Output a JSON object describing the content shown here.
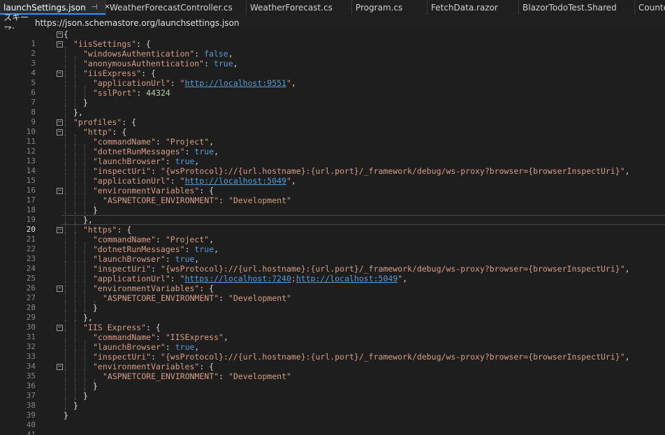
{
  "tabs": [
    {
      "label": "launchSettings.json",
      "active": true
    },
    {
      "label": "WeatherForecastController.cs"
    },
    {
      "label": "WeatherForecast.cs"
    },
    {
      "label": "Program.cs"
    },
    {
      "label": "FetchData.razor"
    },
    {
      "label": "BlazorTodoTest.Shared"
    },
    {
      "label": "Counte"
    }
  ],
  "schema": {
    "label": "スキーマ:",
    "value": "https://json.schemastore.org/launchsettings.json"
  },
  "editor": {
    "current_line": 20,
    "lines": [
      {
        "n": "1",
        "fold": true
      },
      {
        "n": "2",
        "fold": true
      },
      {
        "n": "3"
      },
      {
        "n": "4"
      },
      {
        "n": "5",
        "fold": true
      },
      {
        "n": "6"
      },
      {
        "n": "7"
      },
      {
        "n": "8"
      },
      {
        "n": "9"
      },
      {
        "n": "10",
        "fold": true
      },
      {
        "n": "11",
        "fold": true
      },
      {
        "n": "12"
      },
      {
        "n": "13"
      },
      {
        "n": "14"
      },
      {
        "n": "15"
      },
      {
        "n": "16"
      },
      {
        "n": "17",
        "fold": true
      },
      {
        "n": "18"
      },
      {
        "n": "19"
      },
      {
        "n": "20"
      },
      {
        "n": "21",
        "fold": true
      },
      {
        "n": "22"
      },
      {
        "n": "23"
      },
      {
        "n": "24"
      },
      {
        "n": "25"
      },
      {
        "n": "26"
      },
      {
        "n": "27",
        "fold": true
      },
      {
        "n": "28"
      },
      {
        "n": "29"
      },
      {
        "n": "30"
      },
      {
        "n": "31",
        "fold": true
      },
      {
        "n": "32"
      },
      {
        "n": "33"
      },
      {
        "n": "34"
      },
      {
        "n": "35",
        "fold": true
      },
      {
        "n": "36"
      },
      {
        "n": "37"
      },
      {
        "n": "38"
      },
      {
        "n": "39"
      },
      {
        "n": "40"
      },
      {
        "n": "41"
      }
    ],
    "code": {
      "l1": "{",
      "l2_key": "\"iisSettings\"",
      "l2_rest": ": {",
      "l3_key": "\"windowsAuthentication\"",
      "l3_val": "false",
      "l4_key": "\"anonymousAuthentication\"",
      "l4_val": "true",
      "l5_key": "\"iisExpress\"",
      "l5_rest": ": {",
      "l6_key": "\"applicationUrl\"",
      "l6_q1": "\"",
      "l6_url": "http://localhost:9551",
      "l6_q2": "\"",
      "l7_key": "\"sslPort\"",
      "l7_val": "44324",
      "l8": "}",
      "l9": "},",
      "l10_key": "\"profiles\"",
      "l10_rest": ": {",
      "l11_key": "\"http\"",
      "l11_rest": ": {",
      "l12_key": "\"commandName\"",
      "l12_val": "\"Project\"",
      "l13_key": "\"dotnetRunMessages\"",
      "l13_val": "true",
      "l14_key": "\"launchBrowser\"",
      "l14_val": "true",
      "l15_key": "\"inspectUri\"",
      "l15_val": "\"{wsProtocol}://{url.hostname}:{url.port}/_framework/debug/ws-proxy?browser={browserInspectUri}\"",
      "l16_key": "\"applicationUrl\"",
      "l16_q1": "\"",
      "l16_url": "http://localhost:5049",
      "l16_q2": "\"",
      "l17_key": "\"environmentVariables\"",
      "l17_rest": ": {",
      "l18_key": "\"ASPNETCORE_ENVIRONMENT\"",
      "l18_val": "\"Development\"",
      "l19": "}",
      "l20": "},",
      "l21_key": "\"https\"",
      "l21_rest": ": {",
      "l22_key": "\"commandName\"",
      "l22_val": "\"Project\"",
      "l23_key": "\"dotnetRunMessages\"",
      "l23_val": "true",
      "l24_key": "\"launchBrowser\"",
      "l24_val": "true",
      "l25_key": "\"inspectUri\"",
      "l25_val": "\"{wsProtocol}://{url.hostname}:{url.port}/_framework/debug/ws-proxy?browser={browserInspectUri}\"",
      "l26_key": "\"applicationUrl\"",
      "l26_q1": "\"",
      "l26_url1": "https://localhost:7240",
      "l26_sep": ";",
      "l26_url2": "http://localhost:5049",
      "l26_q2": "\"",
      "l27_key": "\"environmentVariables\"",
      "l27_rest": ": {",
      "l28_key": "\"ASPNETCORE_ENVIRONMENT\"",
      "l28_val": "\"Development\"",
      "l29": "}",
      "l30": "},",
      "l31_key": "\"IIS Express\"",
      "l31_rest": ": {",
      "l32_key": "\"commandName\"",
      "l32_val": "\"IISExpress\"",
      "l33_key": "\"launchBrowser\"",
      "l33_val": "true",
      "l34_key": "\"inspectUri\"",
      "l34_val": "\"{wsProtocol}://{url.hostname}:{url.port}/_framework/debug/ws-proxy?browser={browserInspectUri}\"",
      "l35_key": "\"environmentVariables\"",
      "l35_rest": ": {",
      "l36_key": "\"ASPNETCORE_ENVIRONMENT\"",
      "l36_val": "\"Development\"",
      "l37": "}",
      "l38": "}",
      "l39": "}",
      "l40": "}"
    }
  },
  "colors": {
    "key": "#d69d85",
    "keyword": "#569cd6",
    "number": "#b5cea8",
    "accent": "#3794ff"
  }
}
